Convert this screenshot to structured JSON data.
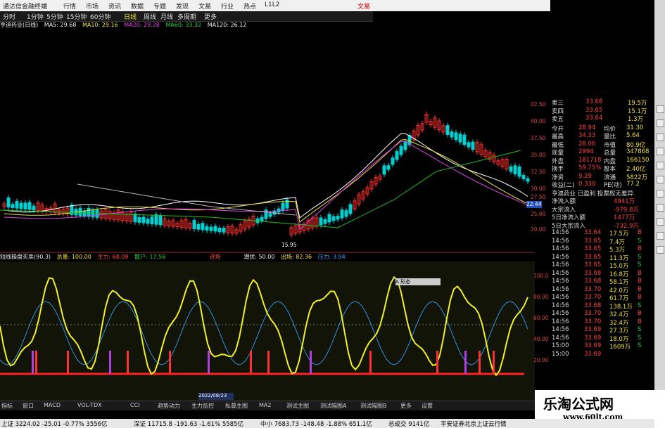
{
  "window": {
    "title": "通达信金融终端",
    "menu": [
      "行情",
      "市场",
      "资讯",
      "数据",
      "专题",
      "发现",
      "文易",
      "行业",
      "热点",
      "L1L2"
    ],
    "right_link": "文易"
  },
  "toolbar": {
    "buttons": [
      "分时",
      "1分钟",
      "5分钟",
      "15分钟",
      "60分钟",
      "日线",
      "周线",
      "月线",
      "多周期",
      "更多"
    ]
  },
  "ma_bar": {
    "stock": "亨迪药业(日线)",
    "ma5": "MA5: 29.68",
    "ma10": "MA10: 29.16",
    "ma20": "MA20: 29.28",
    "ma60": "MA60: 33.32",
    "ma120": "MA120: 26.12"
  },
  "price_axis": [
    "42.50",
    "40.00",
    "37.50",
    "35.00",
    "32.50",
    "30.00",
    "27.50",
    "25.00",
    "22.44",
    "20.00"
  ],
  "chart_labels": {
    "low_marker": "15.95",
    "current_tag": "22.44"
  },
  "indicator_bar": {
    "name": "短线操盘买卖(90,3)",
    "zongliang": "总量: 100.00",
    "zhuli": "主力: 68.09",
    "sanhu": "散户: 17.56",
    "jinchang": "进场",
    "chuchang": "出场: 82.36",
    "yali": "压力: 3.94",
    "qianfu": "潜伏: 50.00"
  },
  "indicator_axis": [
    "100.0",
    "80.00",
    "60.00",
    "40.00",
    "20.00"
  ],
  "popup_label": "A 形态",
  "date_label": "2022/08/23",
  "right_panel": {
    "sell": [
      {
        "l": "卖三",
        "p": "33.68",
        "v": "19.5万"
      },
      {
        "l": "卖四",
        "p": "33.65",
        "v": "15.1万"
      },
      {
        "l": "卖五",
        "p": "33.64",
        "v": "1.3万"
      }
    ],
    "stats": [
      {
        "a": "今开",
        "av": "28.94",
        "b": "均价",
        "bv": "31.30"
      },
      {
        "a": "最高",
        "av": "34.33",
        "b": "量比",
        "bv": "5.64"
      },
      {
        "a": "最低",
        "av": "28.06",
        "b": "市值",
        "bv": "80.9亿"
      },
      {
        "a": "现量",
        "av": "2994",
        "b": "总量",
        "bv": "347868"
      },
      {
        "a": "外盘",
        "av": "181718",
        "b": "内盘",
        "bv": "166150"
      },
      {
        "a": "换手",
        "av": "59.75%",
        "b": "股本",
        "bv": "2.40亿"
      },
      {
        "a": "净资",
        "av": "9.29",
        "b": "流通",
        "bv": "5822万"
      },
      {
        "a": "收益(二)",
        "av": "0.330",
        "b": "PE(动)",
        "bv": "77.2"
      }
    ],
    "company": "亨迪药业 已盈利 投票权无差异",
    "flows": [
      {
        "l": "净流入额",
        "v": "4941万"
      },
      {
        "l": "大宗流入",
        "v": "-979.8万"
      },
      {
        "l": "5日净流入额",
        "v": "1477万"
      },
      {
        "l": "5日大宗流入",
        "v": "-732.9万"
      }
    ],
    "ticks": [
      {
        "t": "14:56",
        "p": "33.64",
        "v": "17.5万",
        "d": "B"
      },
      {
        "t": "14:56",
        "p": "33.65",
        "v": "7.4万",
        "d": "S"
      },
      {
        "t": "14:56",
        "p": "33.65",
        "v": "5.3万",
        "d": "B"
      },
      {
        "t": "14:56",
        "p": "33.65",
        "v": "11.3万",
        "d": "S"
      },
      {
        "t": "14:56",
        "p": "33.65",
        "v": "15.0万",
        "d": "S"
      },
      {
        "t": "14:56",
        "p": "33.68",
        "v": "16.8万",
        "d": "B"
      },
      {
        "t": "14:56",
        "p": "33.68",
        "v": "58.1万",
        "d": "B"
      },
      {
        "t": "14:56",
        "p": "33.70",
        "v": "42.0万",
        "d": "B"
      },
      {
        "t": "14:56",
        "p": "33.70",
        "v": "61.7万",
        "d": "B"
      },
      {
        "t": "14:56",
        "p": "33.68",
        "v": "138.1万",
        "d": "S"
      },
      {
        "t": "14:56",
        "p": "33.70",
        "v": "32.4万",
        "d": "B"
      },
      {
        "t": "14:56",
        "p": "33.70",
        "v": "32.4万",
        "d": "B"
      },
      {
        "t": "14:56",
        "p": "33.69",
        "v": "27.3万",
        "d": "S"
      },
      {
        "t": "14:56",
        "p": "33.69",
        "v": "18.0万",
        "d": "S"
      },
      {
        "t": "15:00",
        "p": "33.69",
        "v": "1609万",
        "d": "S"
      },
      {
        "t": "15:00",
        "p": "33.69",
        "v": "",
        "d": ""
      }
    ]
  },
  "tabs": [
    "指标",
    "窗口",
    "MACD",
    "VOL-TDX",
    "CCI",
    "趋势动力",
    "主力监控",
    "私募主图",
    "MA2",
    "测试主图",
    "测试幅图A",
    "测试幅图B",
    "更多",
    "设置"
  ],
  "status": {
    "sh": "上证 3224.02 -25.01 -0.77% 3556亿",
    "sz": "深证 11715.8 -191.63 -1.61% 5585亿",
    "zx": "中小 7683.73 -148.48 -1.88% 651.1亿",
    "total": "总成交 9141亿",
    "broker": "平安证券北京上证云行情"
  },
  "watermark": {
    "title": "乐淘公式网",
    "url": "www.60lt.com"
  },
  "colors": {
    "up": "#ff3030",
    "down": "#00d0d0",
    "ma5": "#ffffff",
    "ma10": "#f0e040",
    "ma20": "#e040e0",
    "ma60": "#20c020",
    "yellow_line": "#f0f020",
    "blue_line": "#3090e0"
  }
}
